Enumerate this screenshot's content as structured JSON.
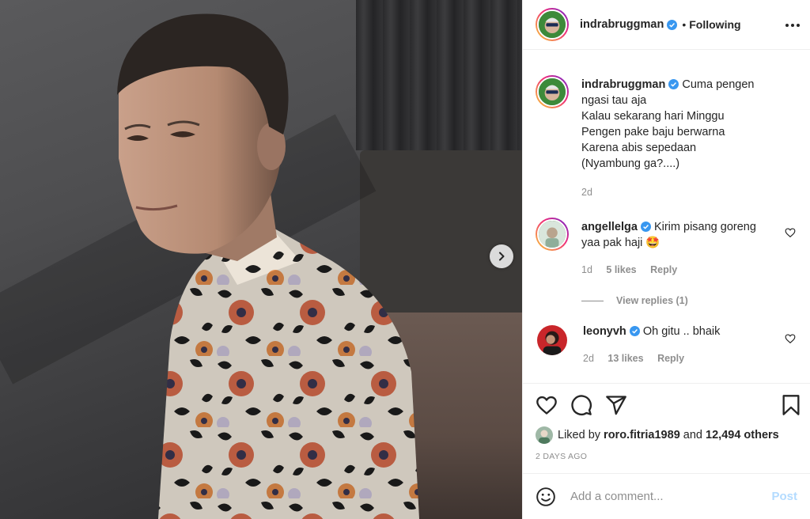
{
  "post": {
    "author": "indrabruggman",
    "follow_status": "Following",
    "separator": "•",
    "next_icon": "chevron-right-icon",
    "more_icon": "more-horizontal-icon"
  },
  "caption": {
    "username": "indrabruggman",
    "lines": [
      "Cuma pengen",
      "ngasi tau aja",
      "Kalau sekarang hari Minggu",
      "Pengen pake baju berwarna",
      "Karena abis sepedaan",
      "(Nyambung ga?....)"
    ],
    "time": "2d"
  },
  "comments": [
    {
      "username": "angellelga",
      "text": "Kirim pisang goreng yaa pak haji",
      "emoji": "🤩",
      "time": "1d",
      "likes": "5 likes",
      "reply": "Reply",
      "view_replies": "View replies (1)"
    },
    {
      "username": "leonyvh",
      "text": "Oh gitu .. bhaik",
      "time": "2d",
      "likes": "13 likes",
      "reply": "Reply"
    }
  ],
  "actions": {
    "icons": [
      "heart-icon",
      "comment-icon",
      "share-icon",
      "bookmark-icon"
    ],
    "liked_prefix": "Liked by",
    "liked_user": "roro.fitria1989",
    "liked_and": "and",
    "liked_others": "12,494 others",
    "post_age": "2 DAYS AGO"
  },
  "add_comment": {
    "placeholder": "Add a comment...",
    "post_label": "Post"
  },
  "colors": {
    "verified": "#3897f0",
    "post_disabled": "#b3dbff",
    "muted": "#8e8e8e"
  }
}
